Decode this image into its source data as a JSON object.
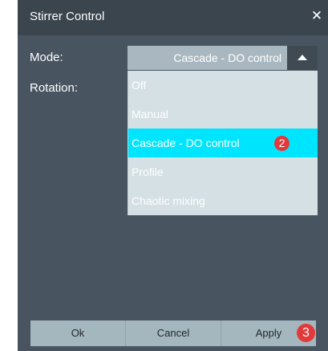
{
  "dialog": {
    "title": "Stirrer Control",
    "close_icon": "✕",
    "background": "#485560"
  },
  "form": {
    "mode_label": "Mode:",
    "rotation_label": "Rotation:"
  },
  "mode_select": {
    "selected_value": "Cascade - DO control",
    "options": [
      "Off",
      "Manual",
      "Cascade - DO control",
      "Profile",
      "Chaotic mixing"
    ],
    "highlighted_index": 2,
    "highlight_color": "#00e5ff"
  },
  "markers": {
    "step2": "2",
    "step3": "3",
    "color": "#e23a3a"
  },
  "footer": {
    "ok_label": "Ok",
    "cancel_label": "Cancel",
    "apply_label": "Apply"
  }
}
